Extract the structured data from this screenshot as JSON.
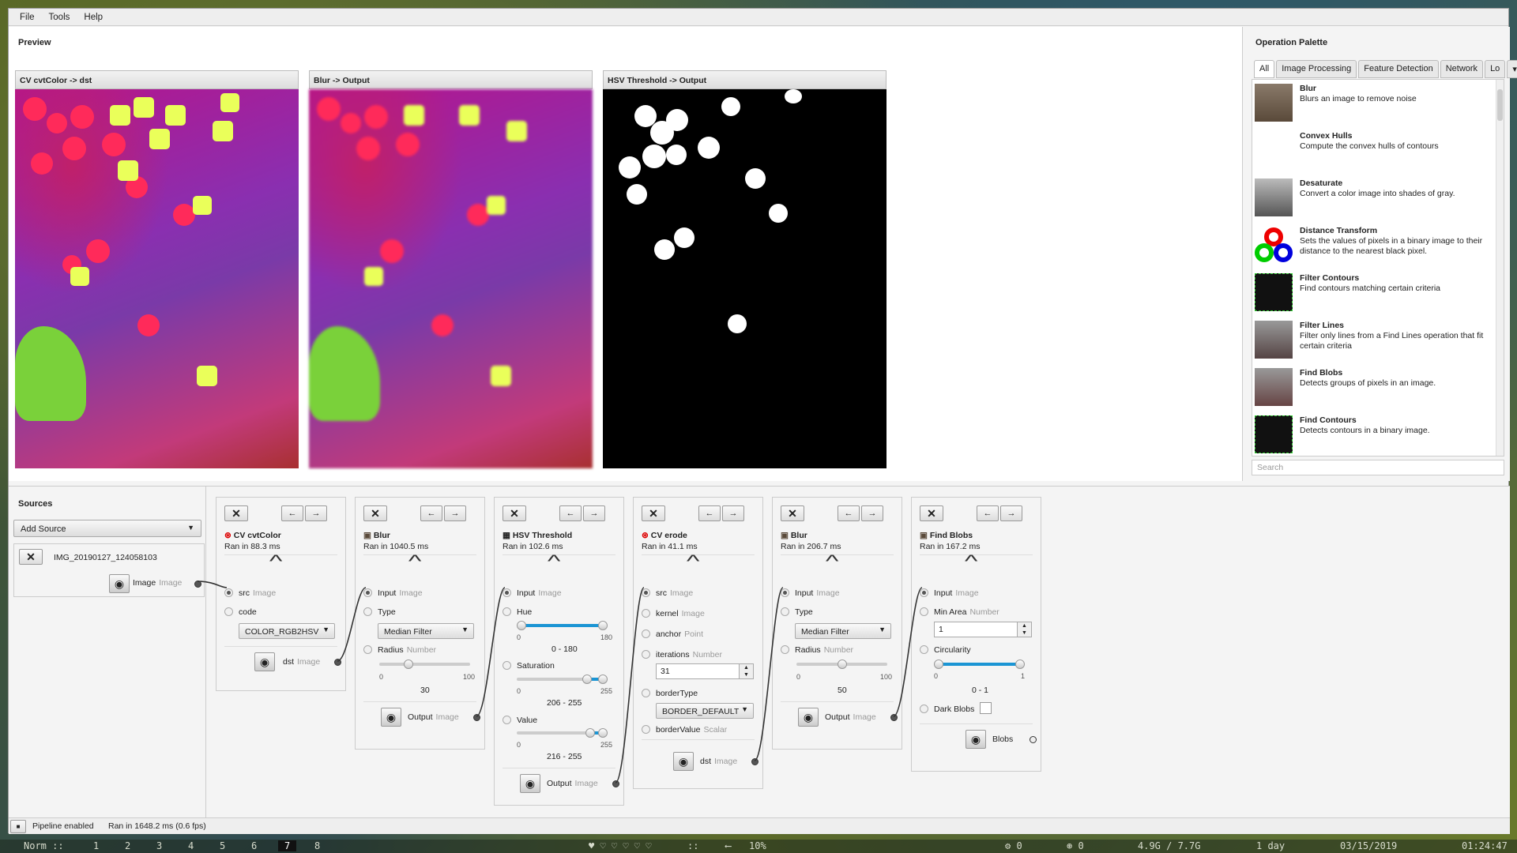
{
  "menu": [
    "File",
    "Tools",
    "Help"
  ],
  "preview": {
    "title": "Preview",
    "panels": [
      {
        "title": "CV cvtColor -> dst"
      },
      {
        "title": "Blur -> Output"
      },
      {
        "title": "HSV Threshold -> Output"
      }
    ]
  },
  "palette": {
    "title": "Operation Palette",
    "tabs": [
      "All",
      "Image Processing",
      "Feature Detection",
      "Network",
      "Lo"
    ],
    "search_placeholder": "Search",
    "ops": [
      {
        "name": "Blur",
        "desc": "Blurs an image to remove noise"
      },
      {
        "name": "Convex Hulls",
        "desc": "Compute the convex hulls of contours"
      },
      {
        "name": "Desaturate",
        "desc": "Convert a color image into shades of gray."
      },
      {
        "name": "Distance Transform",
        "desc": "Sets the values of pixels in a binary image to their distance to the nearest black pixel."
      },
      {
        "name": "Filter Contours",
        "desc": "Find contours matching certain criteria"
      },
      {
        "name": "Filter Lines",
        "desc": "Filter only lines from a Find Lines operation that fit certain criteria"
      },
      {
        "name": "Find Blobs",
        "desc": "Detects groups of pixels in an image."
      },
      {
        "name": "Find Contours",
        "desc": "Detects contours in a binary image."
      }
    ]
  },
  "sources": {
    "title": "Sources",
    "add_label": "Add Source",
    "file": "IMG_20190127_124058103",
    "out_name": "Image",
    "out_type": "Image"
  },
  "steps": {
    "cvt": {
      "title": "CV cvtColor",
      "ran": "Ran in 88.3 ms",
      "src": "src",
      "src_t": "Image",
      "code": "code",
      "code_val": "COLOR_RGB2HSV",
      "dst": "dst",
      "dst_t": "Image"
    },
    "blur1": {
      "title": "Blur",
      "ran": "Ran in 1040.5 ms",
      "in": "Input",
      "in_t": "Image",
      "type": "Type",
      "type_val": "Median Filter",
      "radius": "Radius",
      "radius_t": "Number",
      "min": "0",
      "max": "100",
      "value": "30",
      "out": "Output",
      "out_t": "Image"
    },
    "hsv": {
      "title": "HSV Threshold",
      "ran": "Ran in 102.6 ms",
      "in": "Input",
      "in_t": "Image",
      "hue": "Hue",
      "hue_min": "0",
      "hue_max": "180",
      "hue_val": "0 - 180",
      "sat": "Saturation",
      "sat_min": "0",
      "sat_max": "255",
      "sat_val": "206 - 255",
      "valn": "Value",
      "val_min": "0",
      "val_max": "255",
      "val_val": "216 - 255",
      "out": "Output",
      "out_t": "Image"
    },
    "erode": {
      "title": "CV erode",
      "ran": "Ran in 41.1 ms",
      "src": "src",
      "src_t": "Image",
      "kernel": "kernel",
      "kernel_t": "Image",
      "anchor": "anchor",
      "anchor_t": "Point",
      "iter": "iterations",
      "iter_t": "Number",
      "iter_val": "31",
      "bt": "borderType",
      "bt_val": "BORDER_DEFAULT",
      "bv": "borderValue",
      "bv_t": "Scalar",
      "dst": "dst",
      "dst_t": "Image"
    },
    "blur2": {
      "title": "Blur",
      "ran": "Ran in 206.7 ms",
      "in": "Input",
      "in_t": "Image",
      "type": "Type",
      "type_val": "Median Filter",
      "radius": "Radius",
      "radius_t": "Number",
      "min": "0",
      "max": "100",
      "value": "50",
      "out": "Output",
      "out_t": "Image"
    },
    "blobs": {
      "title": "Find Blobs",
      "ran": "Ran in 167.2 ms",
      "in": "Input",
      "in_t": "Image",
      "minarea": "Min Area",
      "minarea_t": "Number",
      "minarea_val": "1",
      "circ": "Circularity",
      "circ_min": "0",
      "circ_max": "1",
      "circ_val": "0 - 1",
      "dark": "Dark Blobs",
      "out": "Blobs"
    }
  },
  "slider_levels": {
    "blur1_radius": 0.3,
    "blur2_radius": 0.5,
    "hue": [
      0,
      1
    ],
    "sat": [
      0.808,
      1
    ],
    "val": [
      0.847,
      1
    ],
    "circ": [
      0,
      1
    ]
  },
  "status": {
    "pipeline": "Pipeline enabled",
    "ran": "Ran in 1648.2 ms (0.6 fps)"
  },
  "taskbar": {
    "mode": "Norm ::",
    "workspaces": [
      "1",
      "2",
      "3",
      "4",
      "5",
      "6",
      "7",
      "8"
    ],
    "active_ws": "7",
    "hearts": "♥ ♡ ♡ ♡ ♡ ♡",
    "vol": "10%",
    "sep": "::",
    "disk": "⚙ 0",
    "net": "⊛ 0",
    "mem": "4.9G / 7.7G",
    "uptime": "1 day",
    "date": "03/15/2019",
    "time": "01:24:47"
  },
  "colors": {
    "accent": "#1b95d4"
  }
}
